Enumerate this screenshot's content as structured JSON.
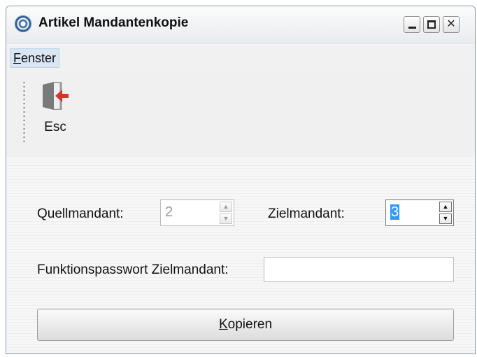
{
  "window": {
    "title": "Artikel Mandantenkopie",
    "controls": {
      "minimize": "minimize",
      "maximize": "maximize",
      "close": "✕"
    }
  },
  "menu": {
    "items": [
      {
        "label_first": "F",
        "label_rest": "enster"
      }
    ]
  },
  "toolbar": {
    "esc_label": "Esc"
  },
  "form": {
    "quellmandant_label": "Quellmandant:",
    "quellmandant_value": "2",
    "zielmandant_label": "Zielmandant:",
    "zielmandant_value": "3",
    "passwort_label": "Funktionspasswort Zielmandant:",
    "passwort_value": "",
    "spin_up": "▲",
    "spin_down": "▼"
  },
  "actions": {
    "copy_first": "K",
    "copy_rest": "opieren"
  },
  "colors": {
    "accent": "#3399ff",
    "exit_icon_arrow": "#d2392b"
  }
}
